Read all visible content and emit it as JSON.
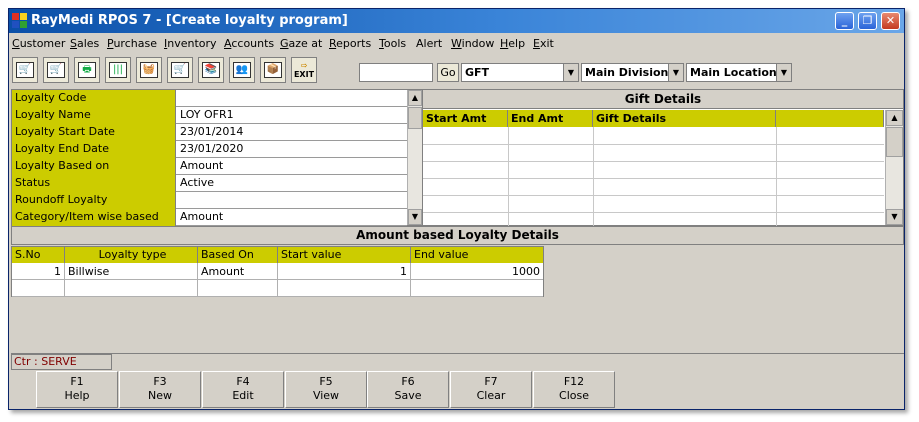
{
  "window": {
    "title": "RayMedi RPOS 7 - [Create loyalty program]",
    "minimize": "_",
    "restore": "❐",
    "close": "✕"
  },
  "menu": [
    {
      "hotkey": "C",
      "rest": "ustomer"
    },
    {
      "hotkey": "S",
      "rest": "ales"
    },
    {
      "hotkey": "P",
      "rest": "urchase"
    },
    {
      "hotkey": "I",
      "rest": "nventory"
    },
    {
      "hotkey": "A",
      "rest": "ccounts"
    },
    {
      "hotkey": "G",
      "rest": "aze at"
    },
    {
      "hotkey": "R",
      "rest": "eports"
    },
    {
      "hotkey": "T",
      "rest": "ools"
    },
    {
      "hotkey": "",
      "rest": "Alert"
    },
    {
      "hotkey": "W",
      "rest": "indow"
    },
    {
      "hotkey": "H",
      "rest": "elp"
    },
    {
      "hotkey": "E",
      "rest": "xit"
    }
  ],
  "toolbar": {
    "search_value": "",
    "go_label": "Go",
    "exit_label": "EXIT",
    "gift_combo": "GFT",
    "division_combo": "Main Division",
    "location_combo": "Main Location"
  },
  "loyalty_info": [
    {
      "label": "Loyalty Code",
      "value": ""
    },
    {
      "label": "Loyalty Name",
      "value": "LOY OFR1"
    },
    {
      "label": "Loyalty Start Date",
      "value": "23/01/2014"
    },
    {
      "label": "Loyalty End Date",
      "value": "23/01/2020"
    },
    {
      "label": "Loyalty Based on",
      "value": "Amount"
    },
    {
      "label": "Status",
      "value": "Active"
    },
    {
      "label": "Roundoff Loyalty",
      "value": ""
    },
    {
      "label": "Category/Item wise based",
      "value": "Amount"
    }
  ],
  "gift_details": {
    "title": "Gift Details",
    "columns": [
      "Start Amt",
      "End Amt",
      "Gift Details",
      ""
    ]
  },
  "amount_details": {
    "title": "Amount based Loyalty Details",
    "columns": [
      "S.No",
      "Loyalty type",
      "Based On",
      "Start value",
      "End value"
    ],
    "rows": [
      {
        "sno": "1",
        "type": "Billwise",
        "based_on": "Amount",
        "start": "1",
        "end": "1000"
      }
    ]
  },
  "status": {
    "ctr": "Ctr : SERVE"
  },
  "fkeys": [
    {
      "key": "F1",
      "label": "Help"
    },
    {
      "key": "F3",
      "label": "New"
    },
    {
      "key": "F4",
      "label": "Edit"
    },
    {
      "key": "F5",
      "label": "View"
    },
    {
      "key": "F6",
      "label": "Save"
    },
    {
      "key": "F7",
      "label": "Clear"
    },
    {
      "key": "F12",
      "label": "Close"
    }
  ]
}
